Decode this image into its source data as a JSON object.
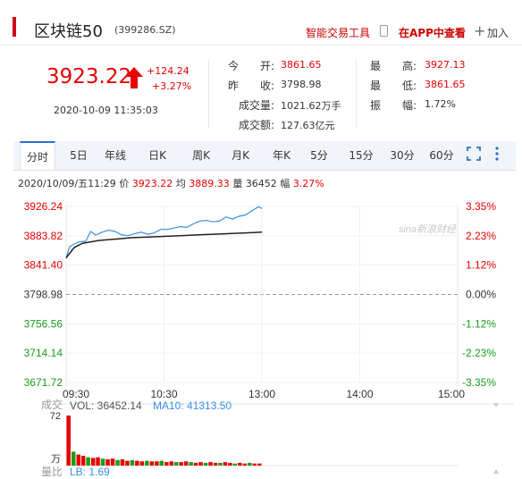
{
  "header": {
    "title": "区块链50",
    "code": "(399286.SZ)",
    "tool_link": "智能交易工具",
    "app_link": "在APP中查看",
    "add_link": "加入",
    "accent": "#d0021b"
  },
  "quote": {
    "price": "3923.22",
    "change": "+124.24",
    "change_pct": "+3.27%",
    "datetime": "2020-10-09 11:35:03",
    "up_color": "#e60000",
    "down_color": "#1a9c1a",
    "stats": [
      {
        "label": "今　　开:",
        "value": "3861.65",
        "color": "#e60000"
      },
      {
        "label": "最　　高:",
        "value": "3927.13",
        "color": "#e60000"
      },
      {
        "label": "昨　　收:",
        "value": "3798.98",
        "color": "#333333"
      },
      {
        "label": "最　　低:",
        "value": "3861.65",
        "color": "#e60000"
      },
      {
        "label": "成交量:",
        "value": "1021.62万手",
        "color": "#333333"
      },
      {
        "label": "振　　幅:",
        "value": "1.72%",
        "color": "#333333"
      },
      {
        "label": "成交额:",
        "value": "127.63亿元",
        "color": "#333333"
      }
    ]
  },
  "tabs": [
    "分时",
    "5日",
    "年线",
    "日K",
    "周K",
    "月K",
    "年K",
    "5分",
    "15分",
    "30分",
    "60分"
  ],
  "active_tab": 0,
  "info_line": {
    "date": "2020/10/09/五11:29",
    "price_label": "价",
    "price": "3923.22",
    "avg_label": "均",
    "avg": "3889.33",
    "vol_label": "量",
    "vol": "36452",
    "amp_label": "幅",
    "amp": "3.27%"
  },
  "watermark": "sina新浪财经",
  "chart_data": {
    "type": "line",
    "y_ticks_left": [
      "3926.24",
      "3883.82",
      "3841.40",
      "3798.98",
      "3756.56",
      "3714.14",
      "3671.72"
    ],
    "y_ticks_right": [
      "3.35%",
      "2.23%",
      "1.12%",
      "0.00%",
      "-1.12%",
      "-2.23%",
      "-3.35%"
    ],
    "x_ticks": [
      "09:30",
      "10:30",
      "13:00",
      "14:00",
      "15:00"
    ],
    "ylim": [
      3671.72,
      3926.24
    ],
    "prev_close": 3798.98,
    "session_minutes": 240,
    "series": [
      {
        "name": "价",
        "color": "#3a8ee6",
        "points": [
          [
            0,
            3851
          ],
          [
            2,
            3868
          ],
          [
            5,
            3872
          ],
          [
            8,
            3875
          ],
          [
            12,
            3876
          ],
          [
            15,
            3890
          ],
          [
            18,
            3885
          ],
          [
            22,
            3889
          ],
          [
            26,
            3892
          ],
          [
            30,
            3890
          ],
          [
            34,
            3885
          ],
          [
            38,
            3884
          ],
          [
            42,
            3887
          ],
          [
            46,
            3889
          ],
          [
            50,
            3886
          ],
          [
            54,
            3888
          ],
          [
            58,
            3893
          ],
          [
            62,
            3893
          ],
          [
            66,
            3895
          ],
          [
            70,
            3897
          ],
          [
            74,
            3896
          ],
          [
            78,
            3901
          ],
          [
            82,
            3905
          ],
          [
            86,
            3906
          ],
          [
            90,
            3904
          ],
          [
            94,
            3905
          ],
          [
            98,
            3911
          ],
          [
            102,
            3908
          ],
          [
            106,
            3912
          ],
          [
            110,
            3914
          ],
          [
            114,
            3920
          ],
          [
            118,
            3926
          ],
          [
            120,
            3923
          ]
        ]
      },
      {
        "name": "均",
        "color": "#222222",
        "points": [
          [
            0,
            3852
          ],
          [
            5,
            3867
          ],
          [
            10,
            3873
          ],
          [
            20,
            3877
          ],
          [
            30,
            3879
          ],
          [
            40,
            3881
          ],
          [
            50,
            3882
          ],
          [
            60,
            3883
          ],
          [
            70,
            3884
          ],
          [
            80,
            3885
          ],
          [
            90,
            3886
          ],
          [
            100,
            3887
          ],
          [
            110,
            3888
          ],
          [
            120,
            3889
          ]
        ]
      }
    ]
  },
  "volume": {
    "title": "成交",
    "vol_label": "VOL: 36452.14",
    "ma_label": "MA10: 41313.50",
    "top_tick": "72",
    "unit_tick": "万",
    "ratio_label": "量比",
    "lb_label": "LB: 1.69",
    "bars": [
      72,
      20,
      16,
      14,
      12,
      11,
      12,
      10,
      9,
      10,
      8,
      9,
      7,
      8,
      7,
      6,
      7,
      6,
      6,
      7,
      5,
      6,
      5,
      5,
      6,
      5,
      4,
      5,
      4,
      5,
      4,
      4,
      5,
      4,
      3,
      4,
      3,
      4,
      3,
      3
    ]
  }
}
